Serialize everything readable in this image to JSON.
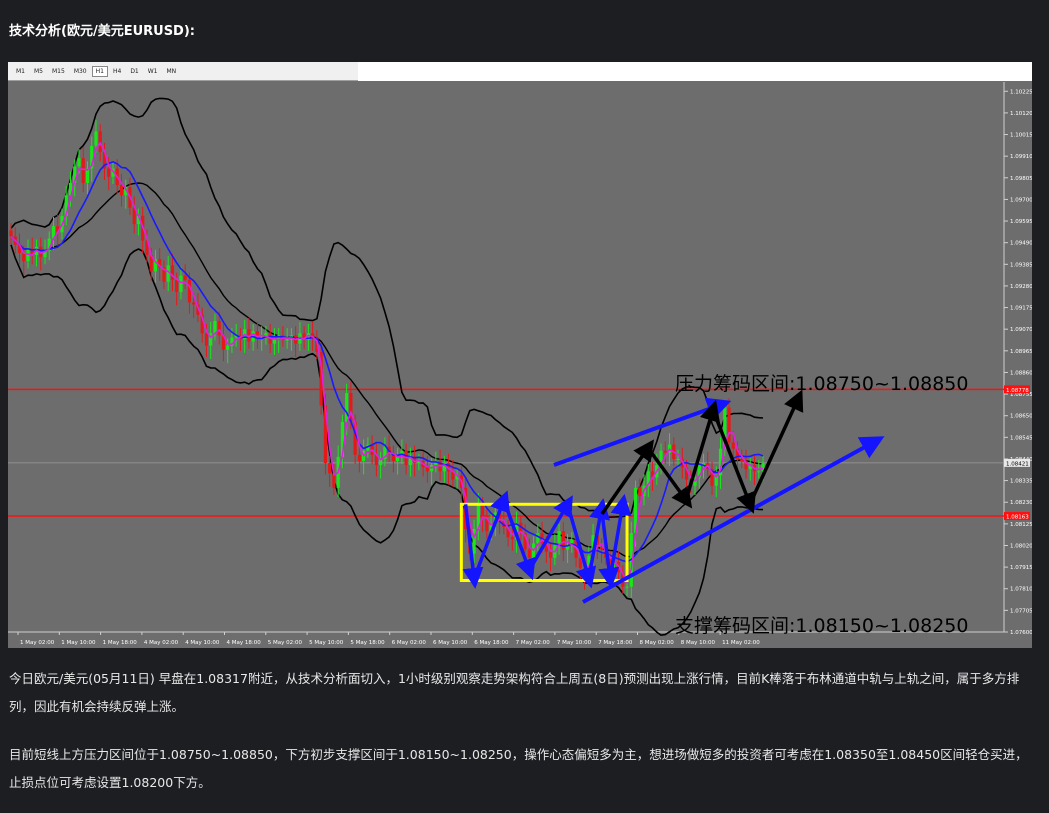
{
  "heading": "技术分析(欧元/美元EURUSD):",
  "timeframes": [
    "M1",
    "M5",
    "M15",
    "M30",
    "H1",
    "H4",
    "D1",
    "W1",
    "MN"
  ],
  "active_timeframe": "H1",
  "paragraphs": [
    "今日欧元/美元(05月11日) 早盘在1.08317附近，从技术分析面切入，1小时级别观察走势架构符合上周五(8日)预测出现上涨行情，目前K棒落于布林通道中轨与上轨之间，属于多方排列，因此有机会持续反弹上涨。",
    "目前短线上方压力区间位于1.08750~1.08850，下方初步支撑区间于1.08150~1.08250，操作心态偏短多为主，想进场做短多的投资者可考虑在1.08350至1.08450区间轻仓买进，止损点位可考虑设置1.08200下方。"
  ],
  "colors": {
    "chart_bg": "#6d6d6d",
    "bull_candle": "#18e818",
    "bear_candle": "#e81818",
    "bollinger": "#000000",
    "ma_blue": "#1a1aff",
    "ma_magenta": "#e020e0",
    "hline": "#ff1010",
    "box": "#ffff00",
    "arrow_blue": "#1414ff",
    "arrow_black": "#000000"
  },
  "chart_data": {
    "type": "candlestick",
    "symbol": "EURUSD",
    "timeframe": "H1",
    "ylim": [
      1.076,
      1.1027
    ],
    "y_ticks": [
      "1.10225",
      "1.10120",
      "1.10015",
      "1.09910",
      "1.09805",
      "1.09700",
      "1.09595",
      "1.09490",
      "1.09385",
      "1.09280",
      "1.09175",
      "1.09070",
      "1.08965",
      "1.08860",
      "1.08755",
      "1.08650",
      "1.08545",
      "1.08440",
      "1.08335",
      "1.08230",
      "1.08125",
      "1.08020",
      "1.07915",
      "1.07810",
      "1.07705",
      "1.07600"
    ],
    "x_ticks": [
      "1 May 02:00",
      "1 May 10:00",
      "1 May 18:00",
      "4 May 02:00",
      "4 May 10:00",
      "4 May 18:00",
      "5 May 02:00",
      "5 May 10:00",
      "5 May 18:00",
      "6 May 02:00",
      "6 May 10:00",
      "6 May 18:00",
      "7 May 02:00",
      "7 May 10:00",
      "7 May 18:00",
      "8 May 02:00",
      "8 May 10:00",
      "11 May 02:00"
    ],
    "current_price_label": "1.08421",
    "hline_labels": [
      "1.08778",
      "1.08163"
    ],
    "horizontal_lines": [
      1.08778,
      1.08163
    ],
    "resistance_label": "压力筹码区间:1.08750~1.08850",
    "support_label": "支撑筹码区间:1.08150~1.08250",
    "range_box": {
      "from_bar": 106,
      "to_bar": 145,
      "low": 1.0785,
      "high": 1.0822
    },
    "close": [
      1.0952,
      1.0948,
      1.0944,
      1.094,
      1.0946,
      1.0943,
      1.0947,
      1.0942,
      1.0945,
      1.0951,
      1.0957,
      1.0954,
      1.0962,
      1.0972,
      1.0978,
      1.0986,
      1.099,
      1.0978,
      1.0985,
      1.0996,
      1.1003,
      1.0993,
      1.0985,
      1.0981,
      1.0985,
      1.0977,
      1.0972,
      1.0976,
      1.0966,
      1.0958,
      1.0962,
      1.095,
      1.0943,
      1.0935,
      1.0941,
      1.0937,
      1.093,
      1.0938,
      1.0931,
      1.0925,
      1.0933,
      1.0931,
      1.092,
      1.0919,
      1.0914,
      1.0905,
      1.0899,
      1.0905,
      1.0911,
      1.0904,
      1.0897,
      1.0899,
      1.0903,
      1.0904,
      1.0902,
      1.0907,
      1.0901,
      1.0906,
      1.0903,
      1.0903,
      1.0905,
      1.09,
      1.0902,
      1.0904,
      1.0902,
      1.0902,
      1.0904,
      1.09,
      1.0905,
      1.0902,
      1.0905,
      1.0903,
      1.0896,
      1.087,
      1.0842,
      1.0837,
      1.083,
      1.0845,
      1.0862,
      1.0876,
      1.0862,
      1.0846,
      1.0843,
      1.0848,
      1.0851,
      1.0846,
      1.0841,
      1.0844,
      1.085,
      1.0847,
      1.0843,
      1.0845,
      1.0848,
      1.0841,
      1.0845,
      1.0842,
      1.0843,
      1.084,
      1.0838,
      1.0841,
      1.0843,
      1.0838,
      1.0842,
      1.0838,
      1.0834,
      1.0836,
      1.083,
      1.081,
      1.0798,
      1.081,
      1.0822,
      1.0815,
      1.0809,
      1.0812,
      1.0818,
      1.0814,
      1.0811,
      1.0806,
      1.0805,
      1.0813,
      1.0808,
      1.08,
      1.0796,
      1.0803,
      1.0808,
      1.0803,
      1.0799,
      1.0796,
      1.0802,
      1.0809,
      1.08,
      1.0802,
      1.0805,
      1.0796,
      1.0791,
      1.0787,
      1.0797,
      1.0807,
      1.0801,
      1.08,
      1.0796,
      1.0793,
      1.0794,
      1.0789,
      1.0782,
      1.0782,
      1.0808,
      1.083,
      1.0826,
      1.0831,
      1.0838,
      1.0835,
      1.0841,
      1.0848,
      1.0847,
      1.0851,
      1.0844,
      1.0844,
      1.084,
      1.0834,
      1.0831,
      1.0835,
      1.0841,
      1.0842,
      1.0839,
      1.0831,
      1.0836,
      1.0849,
      1.0869,
      1.0852,
      1.0849,
      1.0844,
      1.0843,
      1.0839,
      1.0841,
      1.0838,
      1.0838,
      1.0842
    ]
  }
}
